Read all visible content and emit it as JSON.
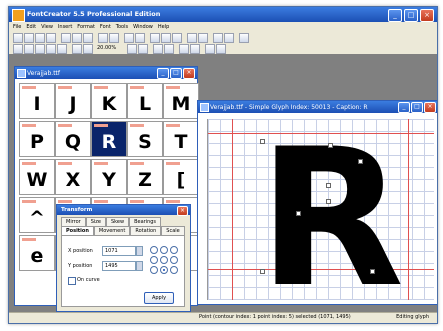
{
  "app": {
    "title": "FontCreator 5.5 Professional Edition",
    "menus": [
      "File",
      "Edit",
      "View",
      "Insert",
      "Format",
      "Font",
      "Tools",
      "Window",
      "Help"
    ],
    "zoom": "20.00%"
  },
  "charmap_window": {
    "title": "Verajjab.ttf",
    "glyphs": [
      [
        "I",
        "J",
        "K",
        "L",
        "M"
      ],
      [
        "P",
        "Q",
        "R",
        "S",
        "T"
      ],
      [
        "W",
        "X",
        "Y",
        "Z",
        "["
      ],
      [
        "^",
        "",
        "",
        " ",
        ""
      ],
      [
        "e",
        "",
        "",
        "",
        ""
      ]
    ],
    "selected": "R"
  },
  "transforms": {
    "title": "Transform",
    "tabs_row1": [
      "Mirror",
      "Size",
      "Skew",
      "Bearings"
    ],
    "tabs_row2": [
      "Position",
      "Movement",
      "Rotation",
      "Scale"
    ],
    "active_tab": "Position",
    "x_label": "X position",
    "x_value": "1071",
    "y_label": "Y position",
    "y_value": "1495",
    "on_curve_label": "On curve",
    "apply_label": "Apply"
  },
  "glyph_window": {
    "title": "Verajjab.ttf - Simple Glyph Index: 50013 - Caption: R",
    "glyph": "R"
  },
  "status": {
    "info": "Point (contour index: 1 point index: 5) selected (1071, 1495)",
    "mode": "Editing glyph"
  },
  "colors": {
    "titlebar": "#1c4fb4",
    "accent": "#0a246a"
  }
}
